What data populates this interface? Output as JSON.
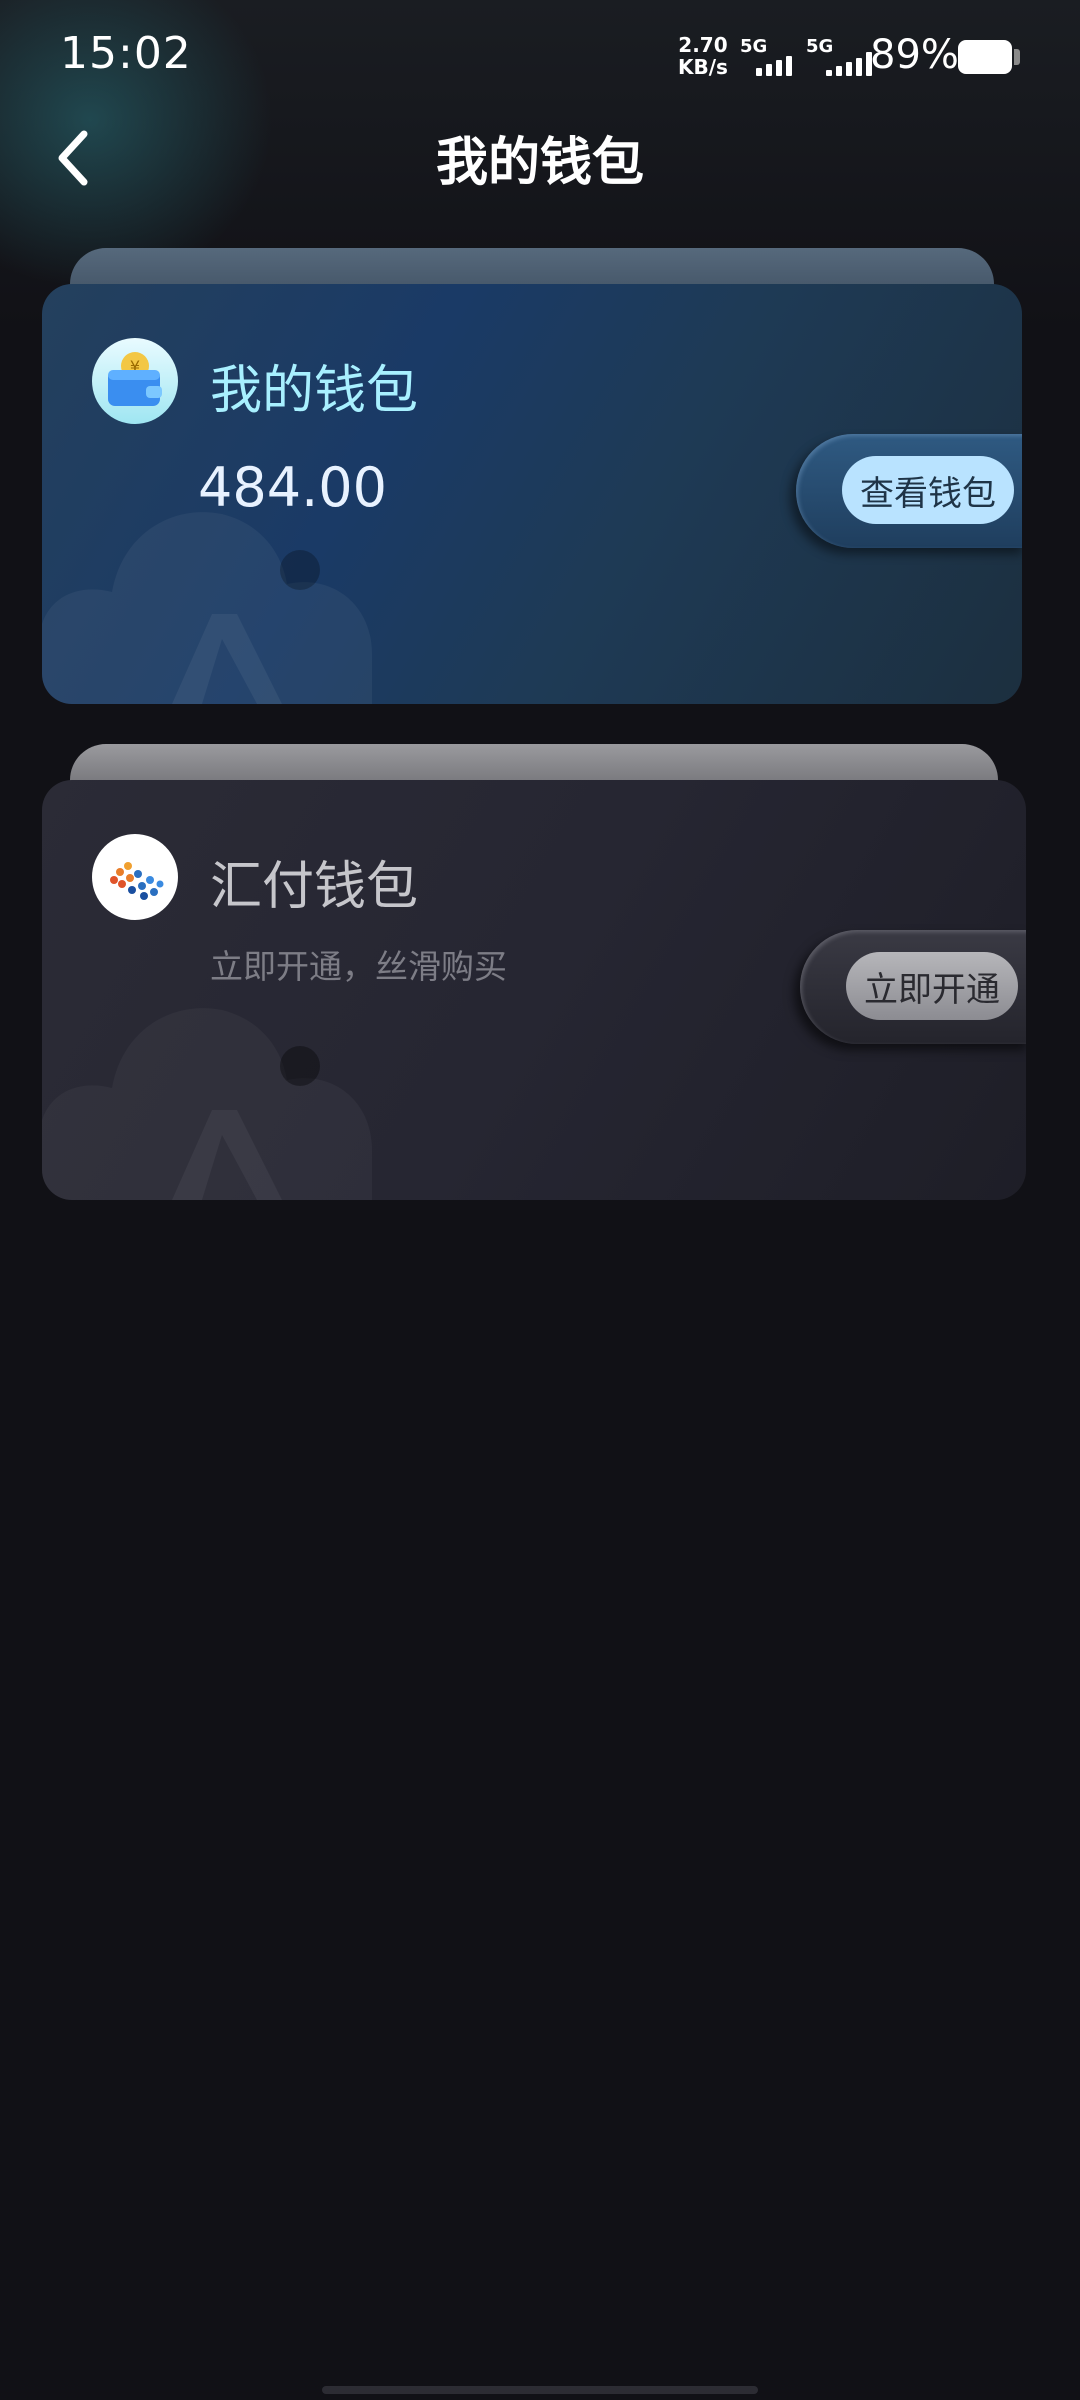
{
  "status_bar": {
    "time": "15:02",
    "net_speed_value": "2.70",
    "net_speed_unit": "KB/s",
    "sim1_label": "5G",
    "sim2_label": "5G",
    "battery_percent": "89%",
    "battery_level": 0.89
  },
  "header": {
    "title": "我的钱包",
    "back_icon": "chevron-left-icon"
  },
  "cards": [
    {
      "title": "我的钱包",
      "balance": "484.00",
      "button_label": "查看钱包",
      "logo_icon": "wallet-icon",
      "accent": "#a8f0ff"
    },
    {
      "title": "汇付钱包",
      "subtitle": "立即开通，丝滑购买",
      "button_label": "立即开通",
      "logo_icon": "huifu-logo-icon"
    }
  ]
}
